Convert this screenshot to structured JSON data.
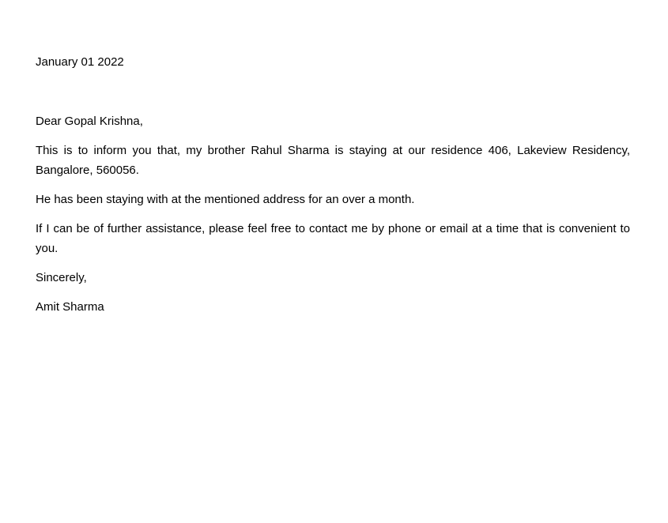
{
  "letter": {
    "date": "January 01 2022",
    "salutation": "Dear Gopal Krishna,",
    "paragraphs": [
      "This is to inform you that, my brother Rahul Sharma is staying at our residence 406, Lakeview Residency, Bangalore, 560056.",
      "He has been staying with at the mentioned address for an over a month.",
      "If I can be of further assistance, please feel free to contact me by phone or email at a time that is convenient to you."
    ],
    "closing": "Sincerely,",
    "signature": "Amit Sharma"
  }
}
